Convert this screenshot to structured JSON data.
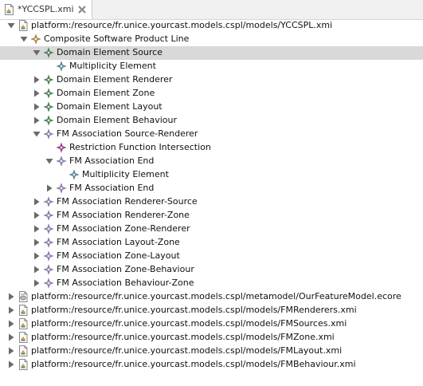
{
  "tab": {
    "title": "*YCCSPL.xmi"
  },
  "tree": {
    "rows": [
      {
        "label": "platform:/resource/fr.unice.yourcast.models.cspl/models/YCCSPL.xmi",
        "expanded": true,
        "icon": "xmi-file-icon"
      },
      {
        "label": "Composite Software Product Line",
        "expanded": true,
        "icon": "composite-spl-icon"
      },
      {
        "label": "Domain Element Source",
        "expanded": true,
        "icon": "domain-element-icon",
        "selected": true
      },
      {
        "label": "Multiplicity Element",
        "icon": "multiplicity-icon"
      },
      {
        "label": "Domain Element Renderer",
        "expanded": false,
        "icon": "domain-element-icon"
      },
      {
        "label": "Domain Element Zone",
        "expanded": false,
        "icon": "domain-element-icon"
      },
      {
        "label": "Domain Element Layout",
        "expanded": false,
        "icon": "domain-element-icon"
      },
      {
        "label": "Domain Element Behaviour",
        "expanded": false,
        "icon": "domain-element-icon"
      },
      {
        "label": "FM Association Source-Renderer",
        "expanded": true,
        "icon": "fm-association-icon"
      },
      {
        "label": "Restriction Function Intersection",
        "icon": "restriction-function-icon"
      },
      {
        "label": "FM Association End",
        "expanded": true,
        "icon": "fm-association-icon"
      },
      {
        "label": "Multiplicity Element",
        "icon": "multiplicity-icon"
      },
      {
        "label": "FM Association End",
        "expanded": false,
        "icon": "fm-association-icon"
      },
      {
        "label": "FM Association Renderer-Source",
        "expanded": false,
        "icon": "fm-association-icon"
      },
      {
        "label": "FM Association Renderer-Zone",
        "expanded": false,
        "icon": "fm-association-icon"
      },
      {
        "label": "FM Association Zone-Renderer",
        "expanded": false,
        "icon": "fm-association-icon"
      },
      {
        "label": "FM Association Layout-Zone",
        "expanded": false,
        "icon": "fm-association-icon"
      },
      {
        "label": "FM Association Zone-Layout",
        "expanded": false,
        "icon": "fm-association-icon"
      },
      {
        "label": "FM Association Zone-Behaviour",
        "expanded": false,
        "icon": "fm-association-icon"
      },
      {
        "label": "FM Association Behaviour-Zone",
        "expanded": false,
        "icon": "fm-association-icon"
      },
      {
        "label": "platform:/resource/fr.unice.yourcast.models.cspl/metamodel/OurFeatureModel.ecore",
        "expanded": false,
        "icon": "ecore-file-icon"
      },
      {
        "label": "platform:/resource/fr.unice.yourcast.models.cspl/models/FMRenderers.xmi",
        "expanded": false,
        "icon": "xmi-file-icon"
      },
      {
        "label": "platform:/resource/fr.unice.yourcast.models.cspl/models/FMSources.xmi",
        "expanded": false,
        "icon": "xmi-file-icon"
      },
      {
        "label": "platform:/resource/fr.unice.yourcast.models.cspl/models/FMZone.xmi",
        "expanded": false,
        "icon": "xmi-file-icon"
      },
      {
        "label": "platform:/resource/fr.unice.yourcast.models.cspl/models/FMLayout.xmi",
        "expanded": false,
        "icon": "xmi-file-icon"
      },
      {
        "label": "platform:/resource/fr.unice.yourcast.models.cspl/models/FMBehaviour.xmi",
        "expanded": false,
        "icon": "xmi-file-icon"
      }
    ]
  },
  "colors": {
    "selection": "#d9d9d9",
    "domain_element": "#3f8a4a",
    "fm_association": "#9b7cc4",
    "restriction": "#b03090",
    "composite": "#c8893a",
    "multiplicity": "#4f8fa0"
  }
}
